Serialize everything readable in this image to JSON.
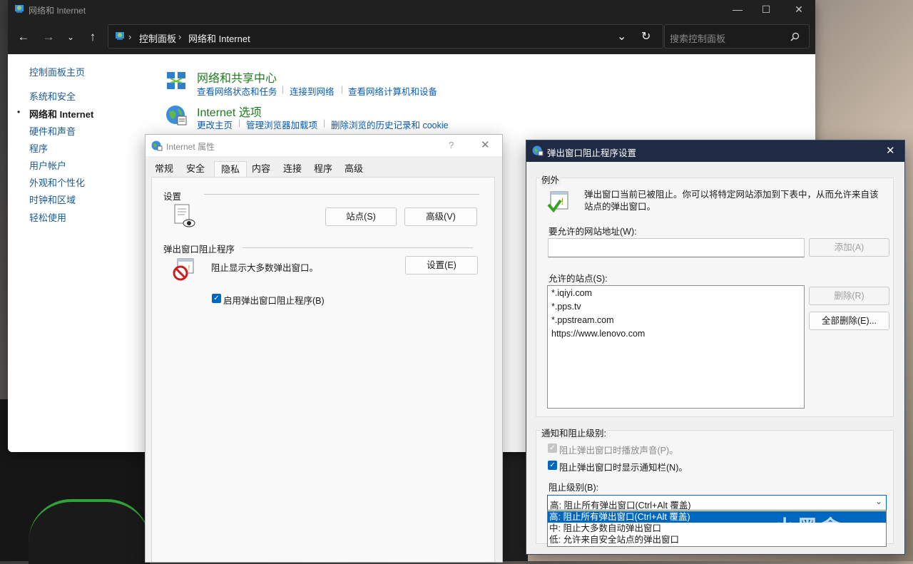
{
  "control_panel": {
    "window_title": "网络和 Internet",
    "breadcrumb": [
      "控制面板",
      "网络和 Internet"
    ],
    "search_placeholder": "搜索控制面板",
    "sidebar": [
      {
        "label": "控制面板主页",
        "current": false
      },
      {
        "label": "系统和安全",
        "current": false
      },
      {
        "label": "网络和 Internet",
        "current": true
      },
      {
        "label": "硬件和声音",
        "current": false
      },
      {
        "label": "程序",
        "current": false
      },
      {
        "label": "用户帐户",
        "current": false
      },
      {
        "label": "外观和个性化",
        "current": false
      },
      {
        "label": "时钟和区域",
        "current": false
      },
      {
        "label": "轻松使用",
        "current": false
      }
    ],
    "categories": [
      {
        "title": "网络和共享中心",
        "links": [
          "查看网络状态和任务",
          "连接到网络",
          "查看网络计算机和设备"
        ]
      },
      {
        "title": "Internet 选项",
        "links": [
          "更改主页",
          "管理浏览器加载项",
          "删除浏览的历史记录和 cookie"
        ]
      }
    ]
  },
  "internet_properties": {
    "title": "Internet 属性",
    "help": "?",
    "tabs": [
      "常规",
      "安全",
      "隐私",
      "内容",
      "连接",
      "程序",
      "高级"
    ],
    "active_tab": "隐私",
    "settings_group": "设置",
    "sites_button": "站点(S)",
    "advanced_button": "高级(V)",
    "popup_group": "弹出窗口阻止程序",
    "popup_desc": "阻止显示大多数弹出窗口。",
    "settings_button": "设置(E)",
    "enable_popup_blocker": {
      "label": "启用弹出窗口阻止程序(B)",
      "checked": true
    }
  },
  "popup_blocker": {
    "title": "弹出窗口阻止程序设置",
    "exceptions_group": "例外",
    "info_text": "弹出窗口当前已被阻止。你可以将特定网站添加到下表中，从而允许来自该站点的弹出窗口。",
    "address_label": "要允许的网站地址(W):",
    "address_value": "",
    "add_button": "添加(A)",
    "allowed_label": "允许的站点(S):",
    "allowed_sites": [
      "*.iqiyi.com",
      "*.pps.tv",
      "*.ppstream.com",
      "https://www.lenovo.com"
    ],
    "remove_button": "删除(R)",
    "remove_all_button": "全部删除(E)...",
    "notify_group": "通知和阻止级别:",
    "play_sound": {
      "label": "阻止弹出窗口时播放声音(P)。",
      "checked": true,
      "enabled": false
    },
    "show_bar": {
      "label": "阻止弹出窗口时显示通知栏(N)。",
      "checked": true
    },
    "level_label": "阻止级别(B):",
    "level_selected": "高: 阻止所有弹出窗口(Ctrl+Alt 覆盖)",
    "level_options": [
      "高: 阻止所有弹出窗口(Ctrl+Alt 覆盖)",
      "中: 阻止大多数自动弹出窗口",
      "低: 允许来自安全站点的弹出窗口"
    ]
  },
  "watermark": "小黑盒",
  "colors": {
    "accent": "#0067c0",
    "dark_titlebar": "#202020",
    "link": "#0b5bb5",
    "category_title": "#1e7b1e",
    "popup_titlebar": "#1f2b44"
  }
}
